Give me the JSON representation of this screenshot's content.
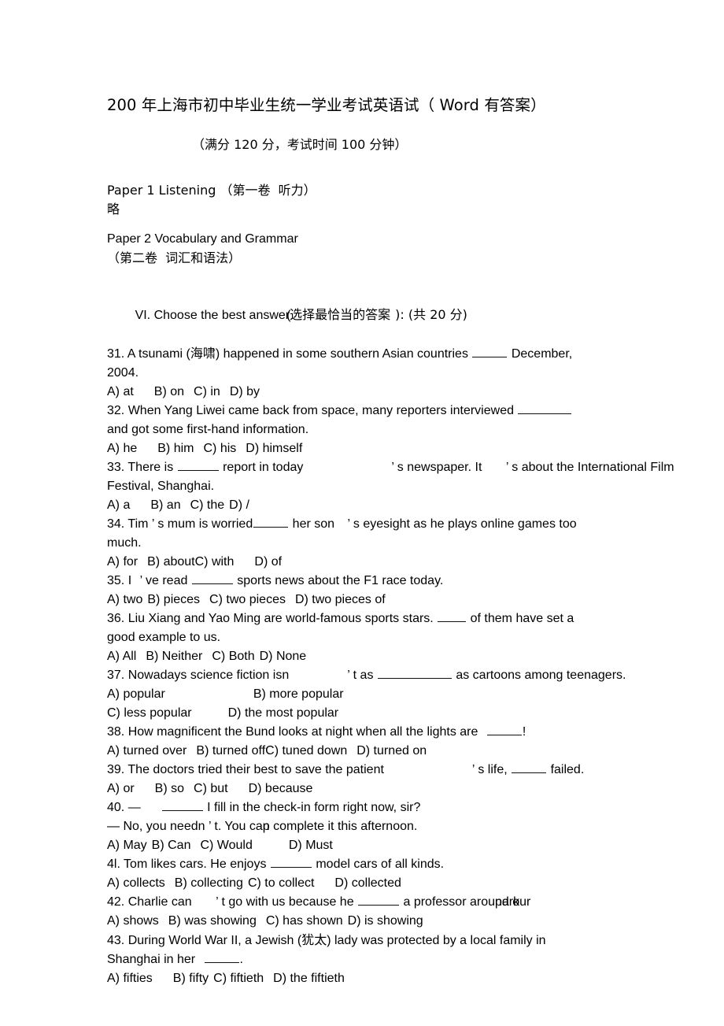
{
  "document": {
    "title": "200  年上海市初中毕业生统一学业考试英语试（    Word  有答案）",
    "subtitle": "（满分 120 分，考试时间  100 分钟）",
    "papers": {
      "paper1_line": "Paper 1 Listening （第一卷  听力）",
      "paper1_note": "略",
      "paper2_line": "Paper 2 Vocabulary and Grammar",
      "paper2_sub": "（第二卷  词汇和语法）"
    },
    "section": {
      "heading_en": "VI. Choose the best answer",
      "heading_paren": "(",
      "heading_cn": "选择最恰当的答案",
      "heading_tail": "): (共 20 分)"
    },
    "questions": [
      {
        "number": "31.",
        "stem_parts": [
          "31. A tsunami (",
          "海啸",
          ") happened in some southern Asian countries ",
          " December,"
        ],
        "continuation": "2004.",
        "options": [
          "A) at",
          "B) on",
          "C) in",
          "D) by"
        ]
      },
      {
        "number": "32.",
        "stem": "32. When Yang Liwei came back from space, many reporters interviewed ",
        "continuation": "and got some first-hand information.",
        "options": [
          "A) he",
          "B) him",
          "C) his",
          "D) himself"
        ]
      },
      {
        "number": "33.",
        "stem_a": "33. There is ",
        "stem_b": " report in today",
        "stem_c": "’",
        "stem_d": " s newspaper. It ",
        "stem_e": "’",
        "stem_f": " s about the International Film",
        "continuation": "Festival, Shanghai.",
        "options": [
          "A) a",
          "B) an",
          "C) the",
          "D) /"
        ]
      },
      {
        "number": "34.",
        "stem_a": "34. Tim ",
        "stem_b": "’",
        "stem_c": " s mum is worried",
        "stem_d": " her son ",
        "stem_e": "’",
        "stem_f": " s eyesight as he plays online games too",
        "continuation": "much.",
        "options": [
          "A) for",
          "B) about",
          "C) with",
          "D) of"
        ]
      },
      {
        "number": "35.",
        "stem_a": "35. I ",
        "stem_b": "’",
        "stem_c": " ve read ",
        "stem_d": " sports news about the F1 race today.",
        "options": [
          "A) two",
          "B) pieces",
          "C) two pieces",
          "D) two pieces of"
        ]
      },
      {
        "number": "36.",
        "stem_a": "36. Liu Xiang and Yao Ming are world-famous sports stars. ",
        "stem_b": " of them have set a",
        "continuation": "good example to us.",
        "options": [
          "A) All",
          "B) Neither",
          "C) Both",
          "D) None"
        ]
      },
      {
        "number": "37.",
        "stem_a": "37. Nowadays science fiction isn",
        "stem_b": "’",
        "stem_c": " t as ",
        "stem_d": " as cartoons among teenagers.",
        "options_row1": [
          "A) popular",
          "B) more popular"
        ],
        "options_row2": [
          "C) less popular",
          "D) the most popular"
        ]
      },
      {
        "number": "38.",
        "stem": "38. How magnificent the Bund looks at night when all the lights are ",
        "stem_tail": "!",
        "options": [
          "A) turned over",
          "B) turned off",
          "C) tuned down",
          "D) turned on"
        ]
      },
      {
        "number": "39.",
        "stem_a": "39. The doctors tried their best to save the patient",
        "stem_b": "’",
        "stem_c": " s life, ",
        "stem_d": " failed.",
        "options": [
          "A) or",
          "B) so",
          "C) but",
          "D) because"
        ]
      },
      {
        "number": "40.",
        "stem_a": "40. ―",
        "stem_b": " I fill in the check-in form right now, sir?",
        "stem_line2_a": "― No, you needn ",
        "stem_line2_b": "’",
        "stem_line2_c": " t. You ca",
        "stem_line2_overlap_under": "n comp",
        "stem_line2_overlap_over": "p",
        "stem_line2_d": "lete it this afternoon.",
        "options": [
          "A) May",
          "B) Can",
          "C) Would",
          "D) Must"
        ]
      },
      {
        "number": "4l.",
        "stem_a": "4l. Tom likes cars. He enjoys ",
        "stem_b": " model cars of all kinds.",
        "options": [
          "A) collects",
          "B) collecting",
          "C) to collect",
          "D) collected"
        ]
      },
      {
        "number": "42.",
        "stem_a": "42. Charlie can ",
        "stem_b": "’",
        "stem_c": " t go with us because he ",
        "stem_d": " a professor arou",
        "stem_overlap_under": "nd our",
        "stem_overlap_over": "park",
        "options": [
          "A) shows",
          "B) was showing",
          "C) has shown",
          "D) is showing"
        ]
      },
      {
        "number": "43.",
        "stem_parts": [
          "43. During World War II, a Jewish (",
          "犹太",
          ") lady was protected by a local family in"
        ],
        "continuation_a": "Shanghai in her ",
        "continuation_b": ".",
        "options": [
          "A) fifties",
          "B) fifty",
          "C) fiftieth",
          "D) the fiftieth"
        ]
      }
    ]
  }
}
